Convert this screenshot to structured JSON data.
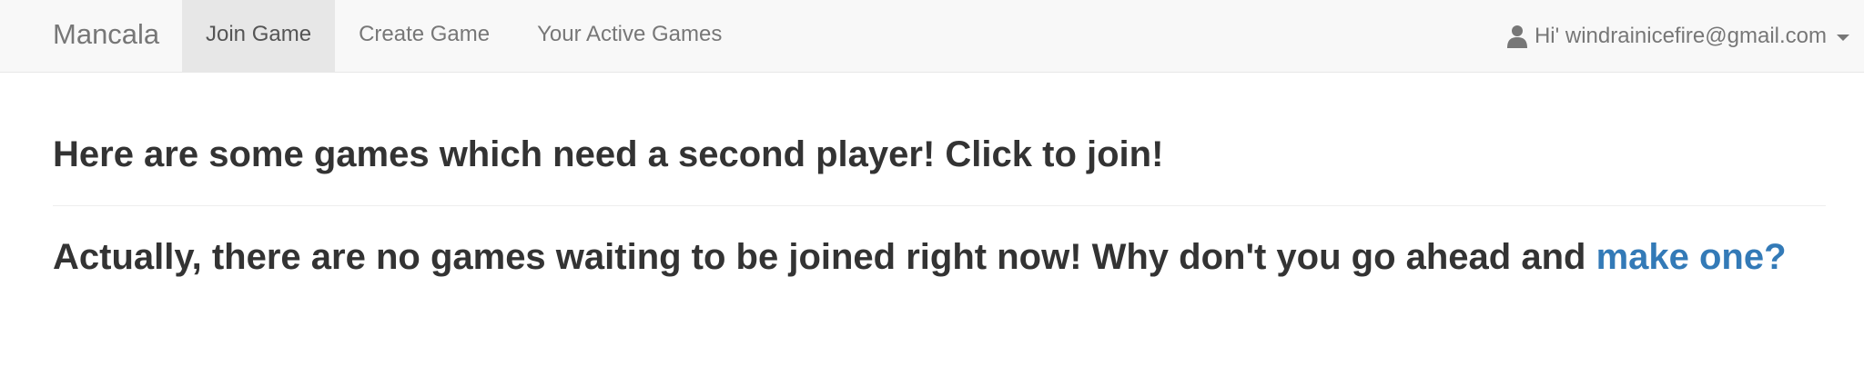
{
  "navbar": {
    "brand": "Mancala",
    "items": [
      {
        "label": "Join Game",
        "active": true
      },
      {
        "label": "Create Game",
        "active": false
      },
      {
        "label": "Your Active Games",
        "active": false
      }
    ],
    "user": {
      "greeting": "Hi' windrainicefire@gmail.com",
      "icon": "user-icon"
    }
  },
  "main": {
    "heading": "Here are some games which need a second player! Click to join!",
    "message": "Actually, there are no games waiting to be joined right now! Why don't you go ahead and ",
    "link_text": "make one?"
  },
  "colors": {
    "link": "#337ab7",
    "navbar_bg": "#f8f8f8",
    "active_tab_bg": "#e7e7e7",
    "text": "#333333"
  }
}
